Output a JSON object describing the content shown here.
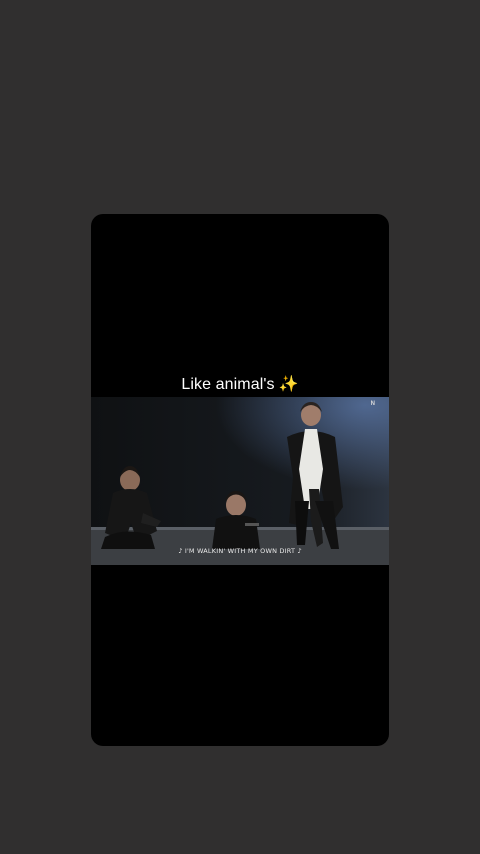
{
  "story": {
    "caption_text": "Like animal's",
    "caption_emoji": "✨",
    "video": {
      "lyric_text": "♪ I'M WALKIN' WITH MY OWN DIRT ♪",
      "watermark_text": "N"
    }
  },
  "colors": {
    "page_background": "#302f2f",
    "card_background": "#000000",
    "caption_text": "#ffffff"
  }
}
